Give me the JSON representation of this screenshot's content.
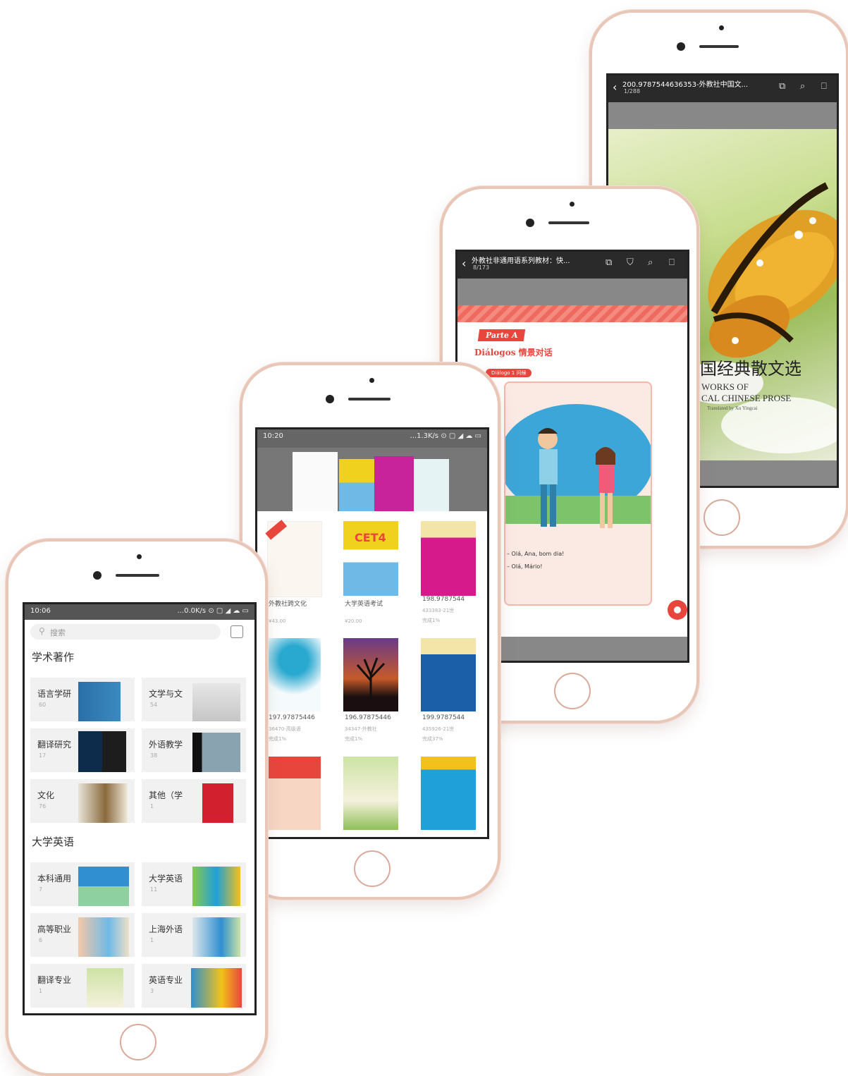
{
  "phone_library": {
    "status_time": "10:06",
    "status_right": "...0.0K/s ⊙ ▢ ◢ ☁ ▭",
    "search_placeholder": "搜索",
    "section1": "学术著作",
    "tiles1": [
      {
        "label": "语言学研",
        "count": "60"
      },
      {
        "label": "文学与文",
        "count": "54"
      },
      {
        "label": "翻译研究",
        "count": "17"
      },
      {
        "label": "外语教学",
        "count": "38"
      },
      {
        "label": "文化",
        "count": "76"
      },
      {
        "label": "其他（学",
        "count": "1"
      }
    ],
    "section2": "大学英语",
    "tiles2": [
      {
        "label": "本科通用",
        "count": "7"
      },
      {
        "label": "大学英语",
        "count": "11"
      },
      {
        "label": "高等职业",
        "count": "6"
      },
      {
        "label": "上海外语",
        "count": "1"
      },
      {
        "label": "翻译专业",
        "count": "1"
      },
      {
        "label": "英语专业",
        "count": "3"
      }
    ]
  },
  "phone_shelf": {
    "status_time": "10:20",
    "status_right": "...1.3K/s ⊙ ▢ ◢ ☁ ▭",
    "books": [
      {
        "title": "外教社跨文化",
        "sub": "...",
        "price": "¥43.00"
      },
      {
        "title": "大学英语考试",
        "sub": "...",
        "price": "¥20.00"
      },
      {
        "title": "198.9787544",
        "sub": "433383-21世",
        "price": "完成1%"
      },
      {
        "title": "197.97875446",
        "sub": "36470-高级语",
        "price": "完成1%"
      },
      {
        "title": "196.97875446",
        "sub": "34347-外教社",
        "price": "完成1%"
      },
      {
        "title": "199.9787544",
        "sub": "435926-21世",
        "price": "完成37%"
      }
    ],
    "cover_cet4": "CET4"
  },
  "phone_dialog": {
    "title": "外教社非通用语系列教材：快...",
    "page": "8/173",
    "part_label": "Parte A",
    "heading": "Diálogos 情景对话",
    "dialog_tag": "Diálogo 1 问候",
    "line1": "– Olá, Ana, bom dia!",
    "line2": "– Olá, Mário!"
  },
  "phone_prose": {
    "title": "200.9787544636353-外教社中国文...",
    "page": "1/288",
    "cn_title": "国经典散文选",
    "en1": "WORKS OF",
    "en2": "CAL CHINESE PROSE",
    "en3": "Translated by Xu Yingcai"
  }
}
